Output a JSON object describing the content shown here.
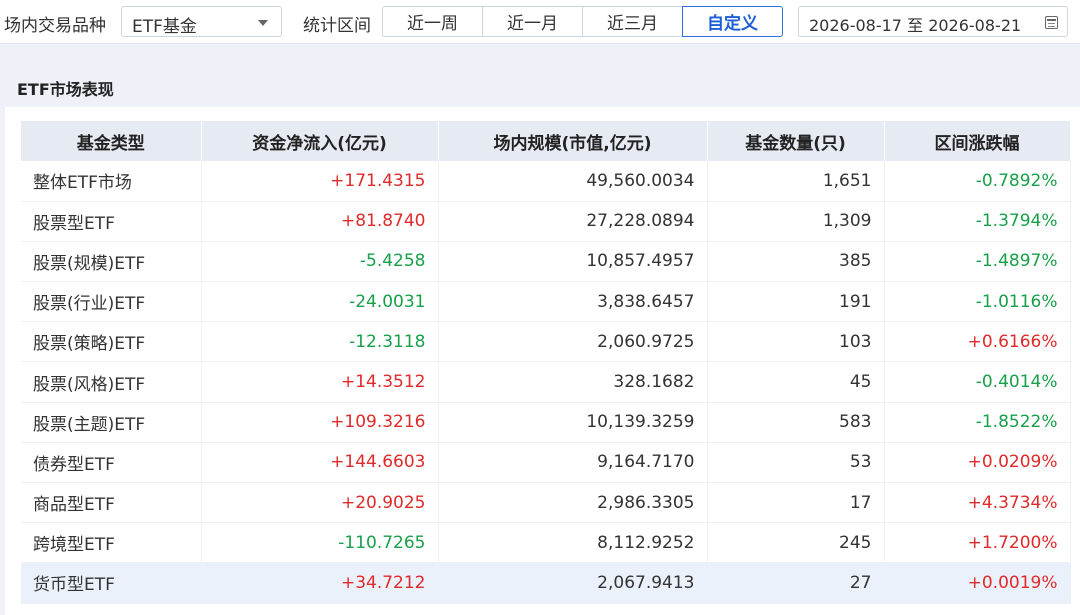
{
  "toolbar": {
    "market_label": "场内交易品种",
    "market_value": "ETF基金",
    "period_label": "统计区间",
    "periods": [
      "近一周",
      "近一月",
      "近三月",
      "自定义"
    ],
    "active_period": "自定义",
    "date_start": "2026-08-17",
    "date_sep": "至",
    "date_end": "2026-08-21"
  },
  "panel": {
    "title": "ETF市场表现"
  },
  "table": {
    "headers": [
      "基金类型",
      "资金净流入(亿元)",
      "场内规模(市值,亿元)",
      "基金数量(只)",
      "区间涨跌幅"
    ],
    "rows": [
      {
        "name": "整体ETF市场",
        "flow": "+171.4315",
        "scale": "49,560.0034",
        "count": "1,651",
        "change": "-0.7892%"
      },
      {
        "name": "股票型ETF",
        "flow": "+81.8740",
        "scale": "27,228.0894",
        "count": "1,309",
        "change": "-1.3794%"
      },
      {
        "name": "股票(规模)ETF",
        "flow": "-5.4258",
        "scale": "10,857.4957",
        "count": "385",
        "change": "-1.4897%"
      },
      {
        "name": "股票(行业)ETF",
        "flow": "-24.0031",
        "scale": "3,838.6457",
        "count": "191",
        "change": "-1.0116%"
      },
      {
        "name": "股票(策略)ETF",
        "flow": "-12.3118",
        "scale": "2,060.9725",
        "count": "103",
        "change": "+0.6166%"
      },
      {
        "name": "股票(风格)ETF",
        "flow": "+14.3512",
        "scale": "328.1682",
        "count": "45",
        "change": "-0.4014%"
      },
      {
        "name": "股票(主题)ETF",
        "flow": "+109.3216",
        "scale": "10,139.3259",
        "count": "583",
        "change": "-1.8522%"
      },
      {
        "name": "债券型ETF",
        "flow": "+144.6603",
        "scale": "9,164.7170",
        "count": "53",
        "change": "+0.0209%"
      },
      {
        "name": "商品型ETF",
        "flow": "+20.9025",
        "scale": "2,986.3305",
        "count": "17",
        "change": "+4.3734%"
      },
      {
        "name": "跨境型ETF",
        "flow": "-110.7265",
        "scale": "8,112.9252",
        "count": "245",
        "change": "+1.7200%"
      },
      {
        "name": "货币型ETF",
        "flow": "+34.7212",
        "scale": "2,067.9413",
        "count": "27",
        "change": "+0.0019%"
      }
    ]
  },
  "colors": {
    "up": "#e02a2a",
    "down": "#17a04a",
    "accent": "#2f6fe0",
    "row_highlight": "#eaf1fb"
  }
}
